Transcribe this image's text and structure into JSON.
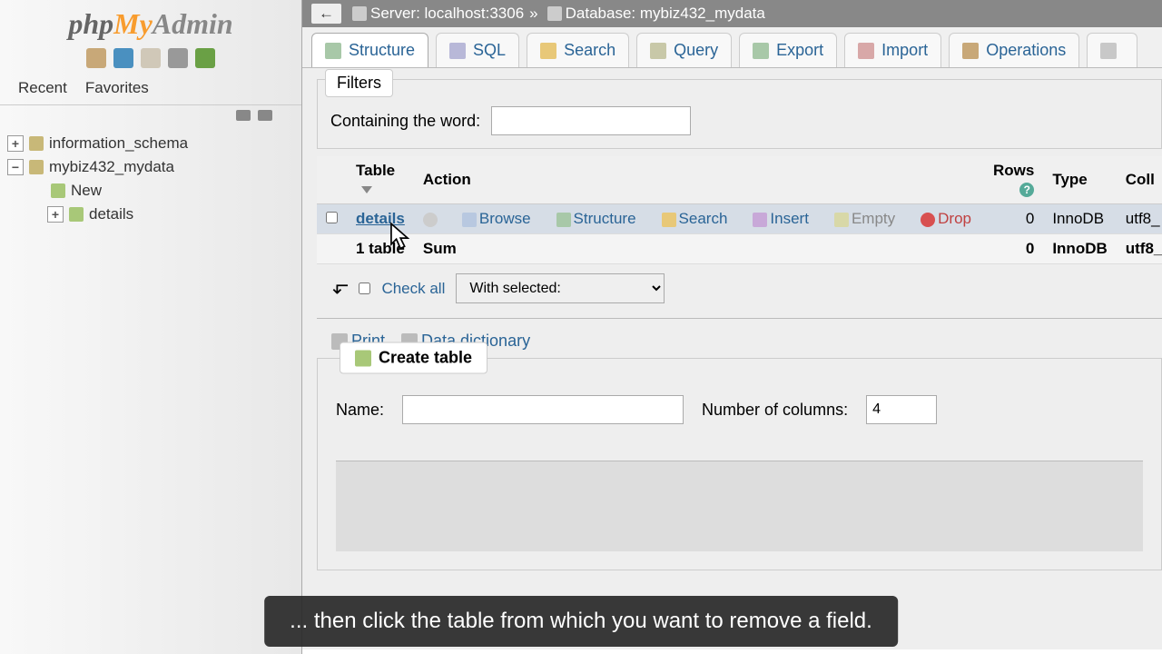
{
  "logo": {
    "php": "php",
    "my": "My",
    "admin": "Admin"
  },
  "recent": {
    "recent": "Recent",
    "favorites": "Favorites"
  },
  "tree": {
    "db1": "information_schema",
    "db2": "mybiz432_mydata",
    "new": "New",
    "table1": "details"
  },
  "breadcrumb": {
    "back": "←",
    "server_label": "Server:",
    "server": "localhost:3306",
    "sep": "»",
    "db_label": "Database:",
    "db": "mybiz432_mydata"
  },
  "tabs": {
    "structure": "Structure",
    "sql": "SQL",
    "search": "Search",
    "query": "Query",
    "export": "Export",
    "import": "Import",
    "operations": "Operations"
  },
  "filters": {
    "legend": "Filters",
    "containing": "Containing the word:"
  },
  "table_header": {
    "table": "Table",
    "action": "Action",
    "rows": "Rows",
    "type": "Type",
    "coll": "Coll"
  },
  "row": {
    "name": "details",
    "browse": "Browse",
    "structure": "Structure",
    "search": "Search",
    "insert": "Insert",
    "empty": "Empty",
    "drop": "Drop",
    "rows": "0",
    "type": "InnoDB",
    "coll": "utf8_"
  },
  "sum": {
    "label": "1 table",
    "sum": "Sum",
    "rows": "0",
    "type": "InnoDB",
    "coll": "utf8_"
  },
  "checkall": {
    "label": "Check all",
    "select": "With selected:"
  },
  "util": {
    "print": "Print",
    "dd": "Data dictionary"
  },
  "create": {
    "legend": "Create table",
    "name": "Name:",
    "cols": "Number of columns:",
    "cols_val": "4"
  },
  "caption": "... then click the table from which you want to remove a field."
}
